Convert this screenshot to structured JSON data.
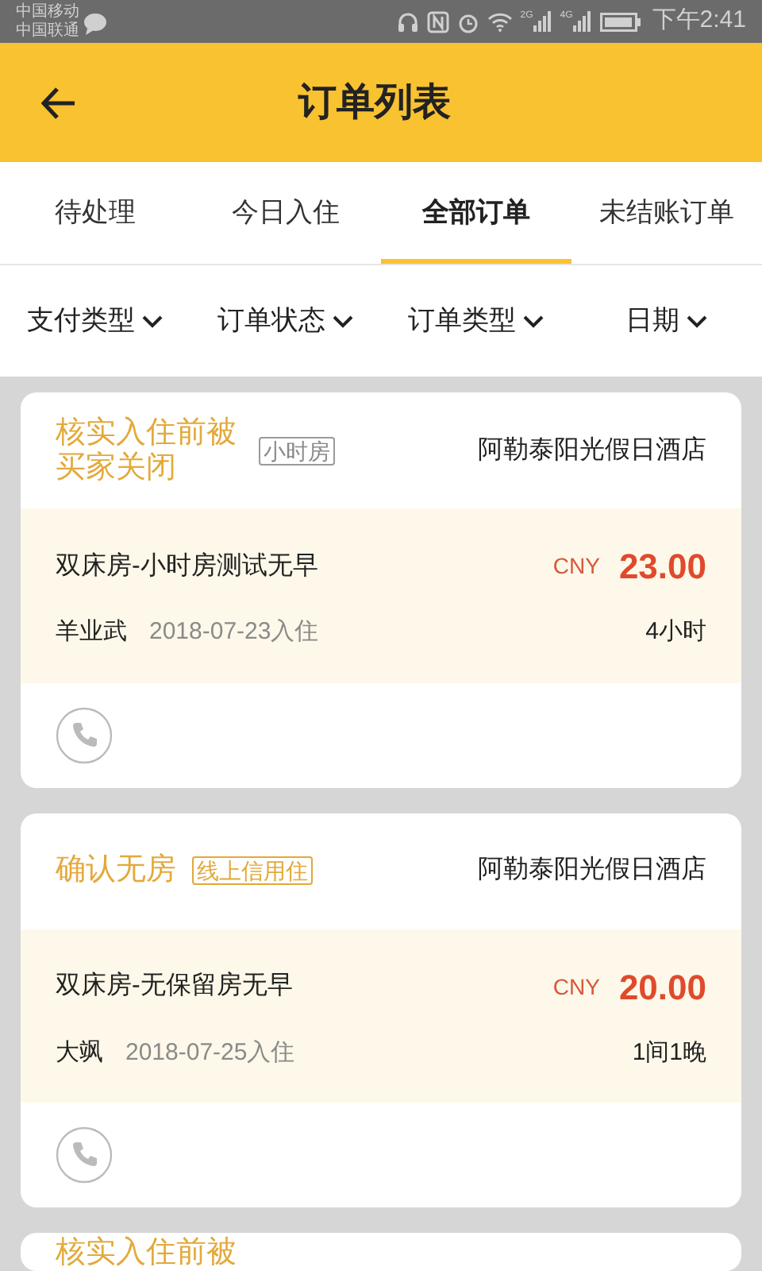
{
  "status_bar": {
    "carriers": [
      "中国移动",
      "中国联通"
    ],
    "network_labels": [
      "2G",
      "4G"
    ],
    "time": "下午2:41"
  },
  "header": {
    "title": "订单列表"
  },
  "tabs": [
    {
      "label": "待处理",
      "selected": false
    },
    {
      "label": "今日入住",
      "selected": false
    },
    {
      "label": "全部订单",
      "selected": true
    },
    {
      "label": "未结账订单",
      "selected": false
    }
  ],
  "filters": [
    {
      "label": "支付类型"
    },
    {
      "label": "订单状态"
    },
    {
      "label": "订单类型"
    },
    {
      "label": "日期"
    }
  ],
  "orders": [
    {
      "status": "核实入住前被买家关闭",
      "tag": {
        "label": "小时房",
        "kind": "hourly"
      },
      "hotel": "阿勒泰阳光假日酒店",
      "room": "双床房-小时房测试无早",
      "currency": "CNY",
      "amount": "23.00",
      "guest": "羊业武",
      "checkin": "2018-07-23入住",
      "duration": "4小时"
    },
    {
      "status": "确认无房",
      "tag": {
        "label": "线上信用住",
        "kind": "credit"
      },
      "hotel": "阿勒泰阳光假日酒店",
      "room": "双床房-无保留房无早",
      "currency": "CNY",
      "amount": "20.00",
      "guest": "大飒",
      "checkin": "2018-07-25入住",
      "duration": "1间1晚"
    },
    {
      "status": "核实入住前被"
    }
  ]
}
